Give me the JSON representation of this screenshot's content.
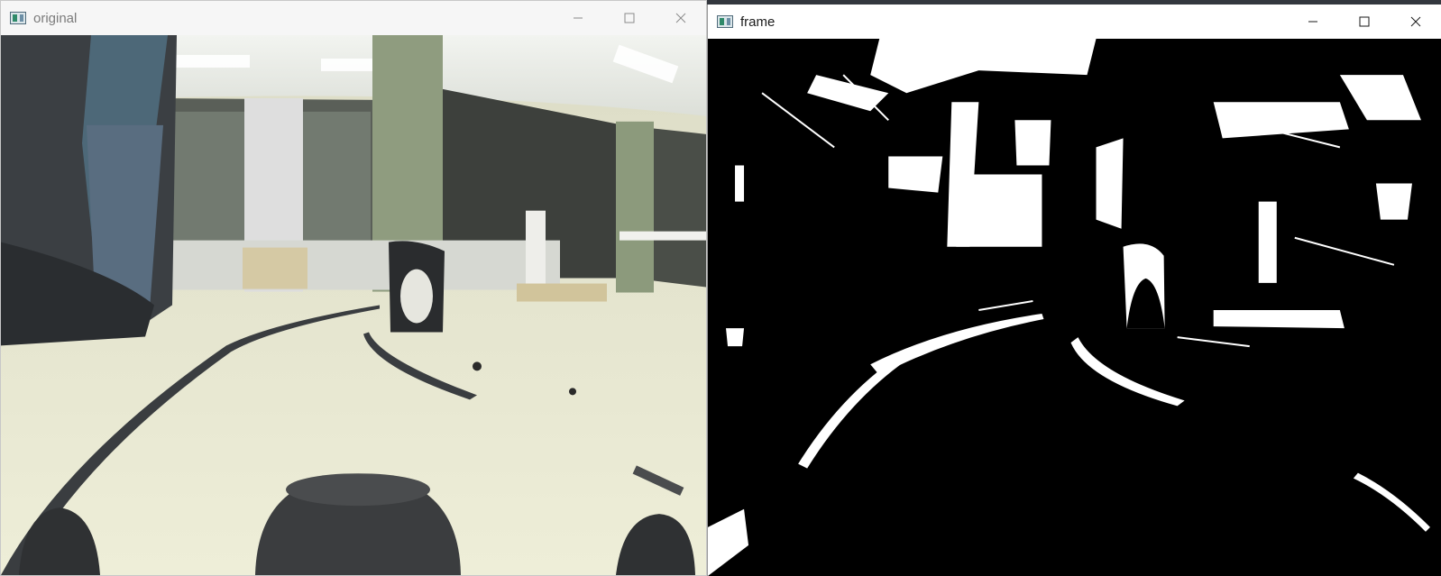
{
  "windows": {
    "left": {
      "title": "original",
      "icon": "opencv-window-icon"
    },
    "right": {
      "title": "frame",
      "icon": "opencv-window-icon"
    }
  },
  "controls": {
    "minimize": "minimize-icon",
    "maximize": "maximize-icon",
    "close": "close-icon"
  },
  "colors": {
    "floor": "#ebe8d2",
    "ceiling": "#e8ebe6",
    "pillar": "#8e9c7c",
    "tape": "#3a3d40",
    "mask_white": "#ffffff",
    "mask_black": "#000000"
  }
}
